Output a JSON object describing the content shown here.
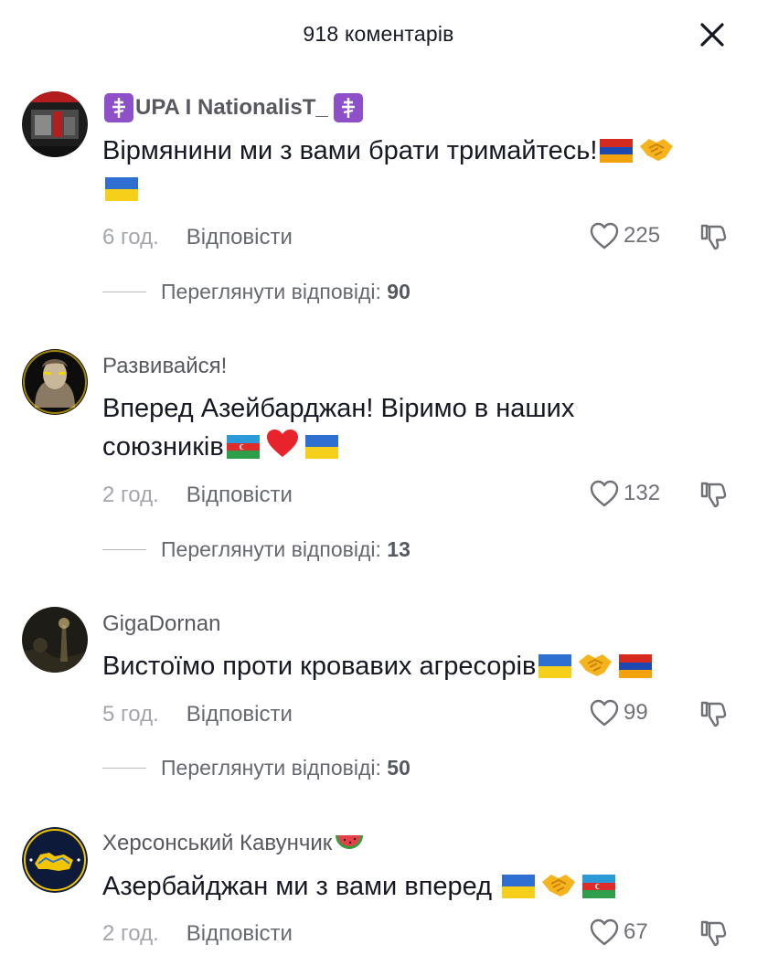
{
  "header": {
    "title": "918 коментарів"
  },
  "comments": [
    {
      "username": "UPA I NationalisT_",
      "text": "Вірмянини ми з вами брати тримайтесь!",
      "time": "6 год.",
      "reply_label": "Відповісти",
      "likes": "225",
      "view_replies_label": "Переглянути відповіді:",
      "view_replies_count": "90"
    },
    {
      "username": "Развивайся!",
      "text_line1": "Вперед Азейбарджан! Віримо в наших",
      "text_line2": "союзників",
      "time": "2 год.",
      "reply_label": "Відповісти",
      "likes": "132",
      "view_replies_label": "Переглянути відповіді:",
      "view_replies_count": "13"
    },
    {
      "username": "GigaDornan",
      "text": "Вистоїмо проти кровавих агресорів",
      "time": "5 год.",
      "reply_label": "Відповісти",
      "likes": "99",
      "view_replies_label": "Переглянути відповіді:",
      "view_replies_count": "50"
    },
    {
      "username": "Херсонський Кавунчик",
      "text": "Азербайджан ми з вами вперед",
      "time": "2 год.",
      "reply_label": "Відповісти",
      "likes": "67"
    }
  ],
  "icons": {
    "close": "close-icon",
    "like": "heart-outline-icon",
    "dislike": "thumbs-down-icon"
  },
  "colors": {
    "text": "#161823",
    "secondary": "#57595f",
    "muted": "#a4a6ab",
    "cross_badge": "#8e50c8"
  }
}
